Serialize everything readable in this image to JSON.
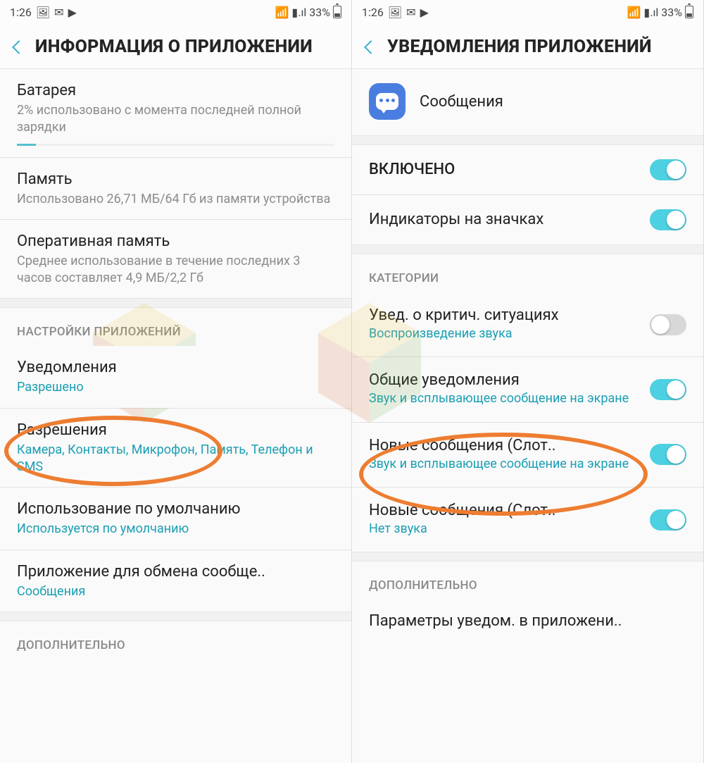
{
  "statusbar": {
    "time": "1:26",
    "battery_pct": "33%"
  },
  "left": {
    "title": "ИНФОРМАЦИЯ О ПРИЛОЖЕНИИ",
    "battery": {
      "title": "Батарея",
      "sub": "2% использовано с момента последней полной зарядки"
    },
    "storage": {
      "title": "Память",
      "sub": "Использовано 26,71 МБ/64 Гб из памяти устройства"
    },
    "ram": {
      "title": "Оперативная память",
      "sub": "Среднее использование в течение последних 3 часов составляет 4,9 МБ/2,2 Гб"
    },
    "section_app_settings": "НАСТРОЙКИ ПРИЛОЖЕНИЙ",
    "notifications": {
      "title": "Уведомления",
      "sub": "Разрешено"
    },
    "permissions": {
      "title": "Разрешения",
      "sub": "Камера, Контакты, Микрофон, Память, Телефон и SMS"
    },
    "default": {
      "title": "Использование по умолчанию",
      "sub": "Используется по умолчанию"
    },
    "share": {
      "title": "Приложение для обмена сообще..",
      "sub": "Сообщения"
    },
    "section_additional": "ДОПОЛНИТЕЛЬНО"
  },
  "right": {
    "title": "УВЕДОМЛЕНИЯ ПРИЛОЖЕНИЙ",
    "app_name": "Сообщения",
    "enabled_label": "ВКЛЮЧЕНО",
    "badge_label": "Индикаторы на значках",
    "section_categories": "КАТЕГОРИИ",
    "critical": {
      "title": "Увед. о критич. ситуациях",
      "sub": "Воспроизведение звука"
    },
    "general": {
      "title": "Общие уведомления",
      "sub": "Звук и всплывающее сообщение на экране"
    },
    "new1": {
      "title": "Новые сообщения (Слот..",
      "sub": "Звук и всплывающее сообщение на экране"
    },
    "new2": {
      "title": "Новые сообщения (Слот..",
      "sub": "Нет звука"
    },
    "section_additional": "ДОПОЛНИТЕЛЬНО",
    "app_settings": "Параметры уведом. в приложени.."
  }
}
